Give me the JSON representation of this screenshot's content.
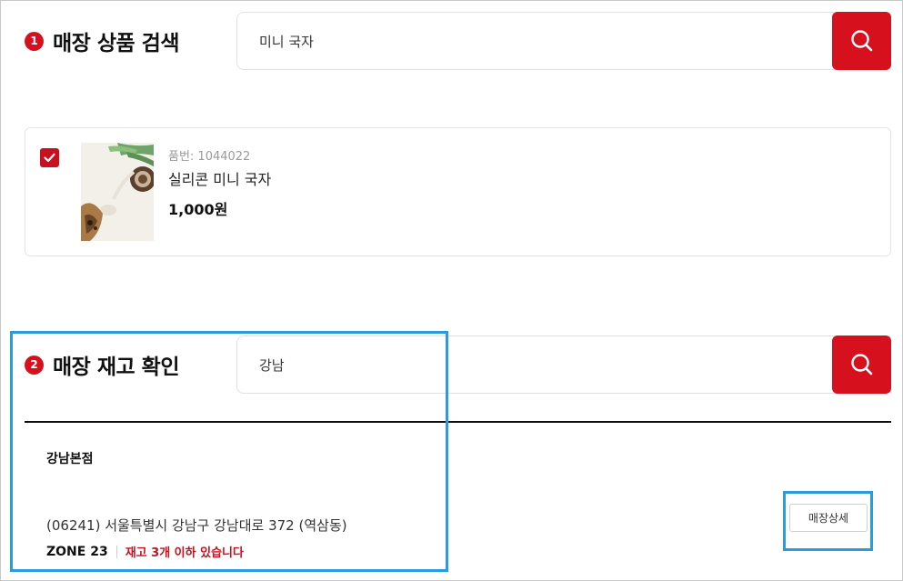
{
  "section1": {
    "step": "1",
    "title": "매장 상품 검색",
    "search_value": "미니 국자",
    "search_icon": "search-icon"
  },
  "product": {
    "checked": true,
    "code": "품번: 1044022",
    "name": "실리콘 미니 국자",
    "price": "1,000원"
  },
  "section2": {
    "step": "2",
    "title": "매장 재고 확인",
    "search_value": "강남",
    "search_icon": "search-icon"
  },
  "store": {
    "name": "강남본점",
    "address": "(06241) 서울특별시 강남구 강남대로 372 (역삼동)",
    "zone": "ZONE 23",
    "stock_text": "재고 3개 이하 있습니다",
    "detail_label": "매장상세"
  },
  "colors": {
    "accent": "#d7101e",
    "highlight": "#2b9be0"
  }
}
